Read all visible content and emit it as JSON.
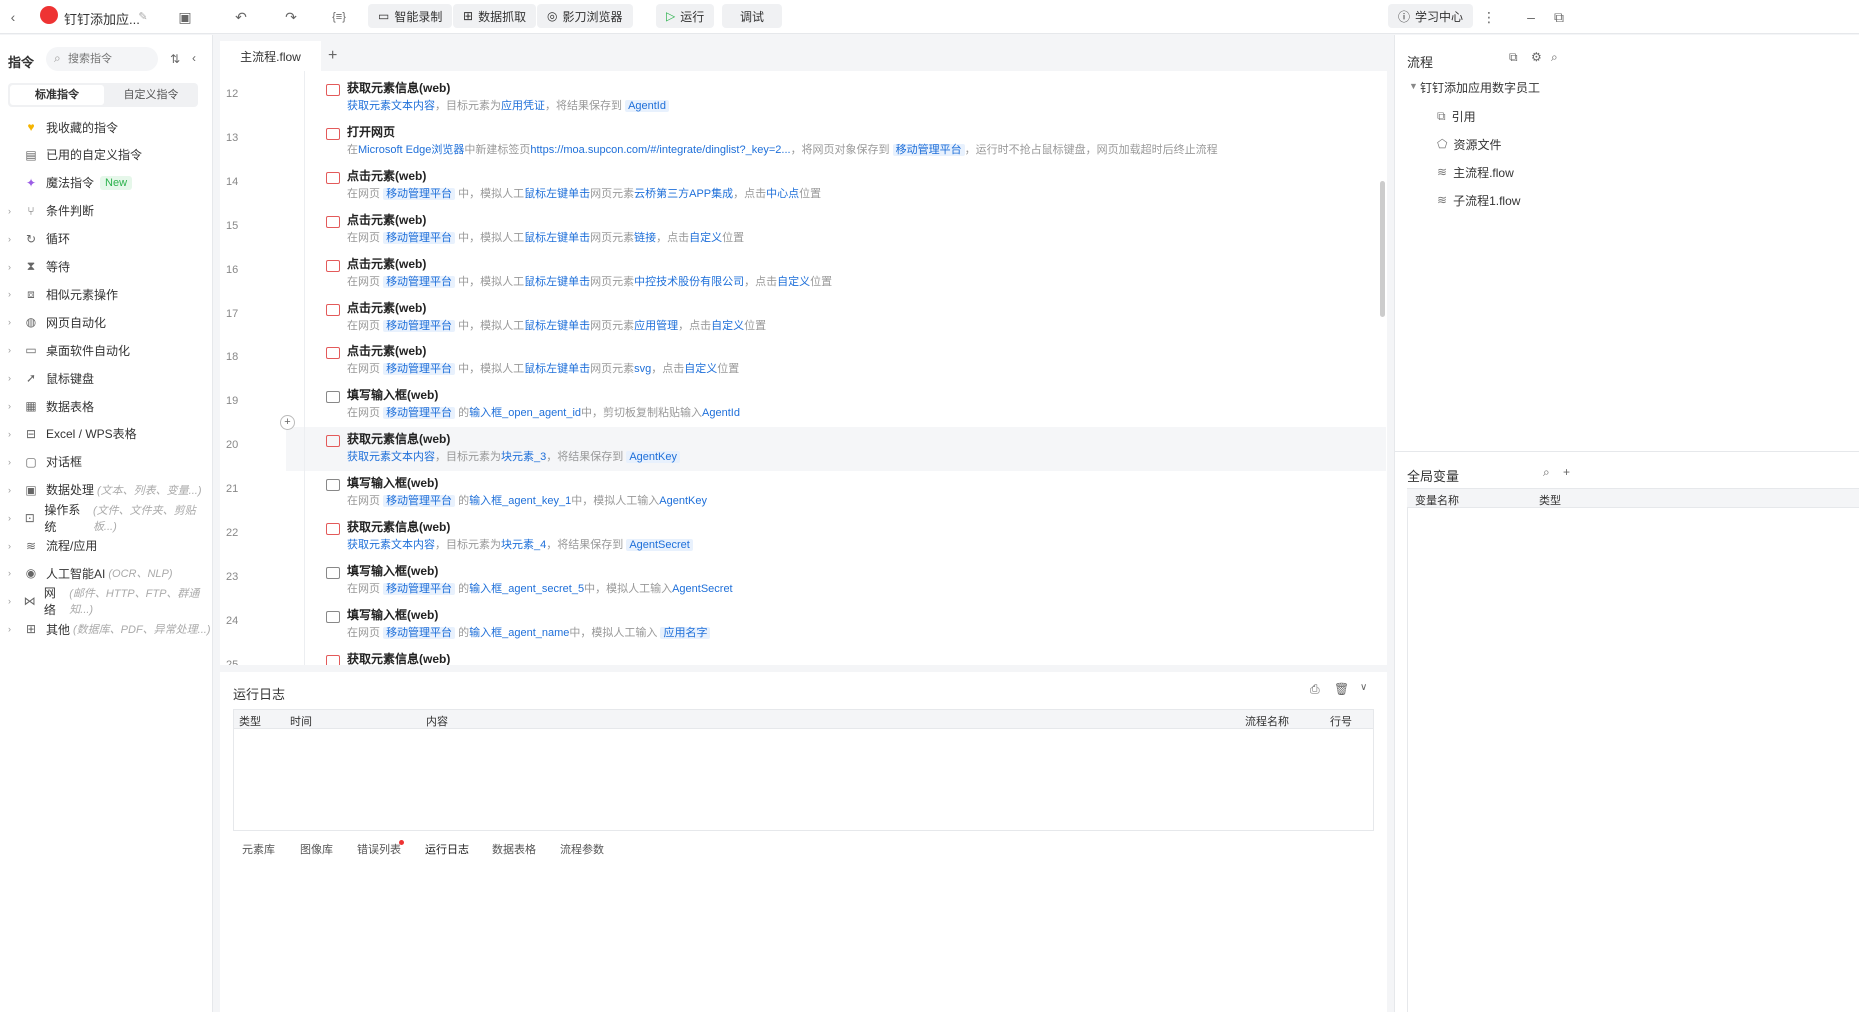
{
  "topbar": {
    "app_title": "钉钉添加应...",
    "buttons": {
      "smart_record": "智能录制",
      "data_capture": "数据抓取",
      "browser": "影刀浏览器",
      "run": "运行",
      "debug": "调试",
      "learning_center": "学习中心"
    },
    "icons": [
      "back-icon",
      "app-logo-icon",
      "edit-icon",
      "save-icon",
      "undo-icon",
      "redo-icon",
      "variable-icon",
      "more-icon",
      "minimize-icon",
      "restore-icon"
    ]
  },
  "leftpanel": {
    "title": "指令",
    "search_placeholder": "搜索指令",
    "tabs": [
      "标准指令",
      "自定义指令"
    ],
    "items": [
      {
        "label": "我收藏的指令",
        "hint": "",
        "icon": "heart-icon"
      },
      {
        "label": "已用的自定义指令",
        "hint": "",
        "icon": "custom-icon"
      },
      {
        "label": "魔法指令",
        "hint": "",
        "badge": "New",
        "icon": "magic-icon"
      },
      {
        "label": "条件判断",
        "hint": "",
        "icon": "branch-icon"
      },
      {
        "label": "循环",
        "hint": "",
        "icon": "loop-icon"
      },
      {
        "label": "等待",
        "hint": "",
        "icon": "hourglass-icon"
      },
      {
        "label": "相似元素操作",
        "hint": "",
        "icon": "similar-icon"
      },
      {
        "label": "网页自动化",
        "hint": "",
        "icon": "globe-icon"
      },
      {
        "label": "桌面软件自动化",
        "hint": "",
        "icon": "desktop-icon"
      },
      {
        "label": "鼠标键盘",
        "hint": "",
        "icon": "cursor-icon"
      },
      {
        "label": "数据表格",
        "hint": "",
        "icon": "table-icon"
      },
      {
        "label": "Excel / WPS表格",
        "hint": "",
        "icon": "excel-icon"
      },
      {
        "label": "对话框",
        "hint": "",
        "icon": "dialog-icon"
      },
      {
        "label": "数据处理",
        "hint": "(文本、列表、变量...)",
        "icon": "data-icon"
      },
      {
        "label": "操作系统",
        "hint": "(文件、文件夹、剪贴板...)",
        "icon": "os-icon"
      },
      {
        "label": "流程/应用",
        "hint": "",
        "icon": "flow-icon"
      },
      {
        "label": "人工智能AI",
        "hint": "(OCR、NLP)",
        "icon": "ai-icon"
      },
      {
        "label": "网络",
        "hint": "(邮件、HTTP、FTP、群通知...)",
        "icon": "network-icon"
      },
      {
        "label": "其他",
        "hint": "(数据库、PDF、异常处理...)",
        "icon": "grid-icon"
      }
    ]
  },
  "editor": {
    "tab": "主流程.flow",
    "rows": [
      {
        "no": "12",
        "title": "获取元素信息(web)",
        "icon": "red",
        "desc": [
          [
            "b",
            "获取元素文本内容"
          ],
          [
            "g",
            "，目标元素为"
          ],
          [
            "b",
            "应用凭证"
          ],
          [
            "g",
            "，将结果保存到 "
          ],
          [
            "c",
            "AgentId"
          ]
        ]
      },
      {
        "no": "13",
        "title": "打开网页",
        "icon": "red",
        "desc": [
          [
            "g",
            "在"
          ],
          [
            "b",
            "Microsoft Edge浏览器"
          ],
          [
            "g",
            "中新建标签页"
          ],
          [
            "b",
            "https://moa.supcon.com/#/integrate/dinglist?_key=2..."
          ],
          [
            "g",
            "，将网页对象保存到 "
          ],
          [
            "c",
            "移动管理平台"
          ],
          [
            "g",
            "，运行时不抢占鼠标键盘，网页加载超时后终止流程"
          ]
        ]
      },
      {
        "no": "14",
        "title": "点击元素(web)",
        "icon": "red",
        "desc": [
          [
            "g",
            "在网页 "
          ],
          [
            "c",
            "移动管理平台"
          ],
          [
            "g",
            " 中，模拟人工"
          ],
          [
            "b",
            "鼠标左键单击"
          ],
          [
            "g",
            "网页元素"
          ],
          [
            "b",
            "云桥第三方APP集成"
          ],
          [
            "g",
            "，点击"
          ],
          [
            "b",
            "中心点"
          ],
          [
            "g",
            "位置"
          ]
        ]
      },
      {
        "no": "15",
        "title": "点击元素(web)",
        "icon": "red",
        "desc": [
          [
            "g",
            "在网页 "
          ],
          [
            "c",
            "移动管理平台"
          ],
          [
            "g",
            " 中，模拟人工"
          ],
          [
            "b",
            "鼠标左键单击"
          ],
          [
            "g",
            "网页元素"
          ],
          [
            "b",
            "链接"
          ],
          [
            "g",
            "，点击"
          ],
          [
            "b",
            "自定义"
          ],
          [
            "g",
            "位置"
          ]
        ]
      },
      {
        "no": "16",
        "title": "点击元素(web)",
        "icon": "red",
        "desc": [
          [
            "g",
            "在网页 "
          ],
          [
            "c",
            "移动管理平台"
          ],
          [
            "g",
            " 中，模拟人工"
          ],
          [
            "b",
            "鼠标左键单击"
          ],
          [
            "g",
            "网页元素"
          ],
          [
            "b",
            "中控技术股份有限公司"
          ],
          [
            "g",
            "，点击"
          ],
          [
            "b",
            "自定义"
          ],
          [
            "g",
            "位置"
          ]
        ]
      },
      {
        "no": "17",
        "title": "点击元素(web)",
        "icon": "red",
        "desc": [
          [
            "g",
            "在网页 "
          ],
          [
            "c",
            "移动管理平台"
          ],
          [
            "g",
            " 中，模拟人工"
          ],
          [
            "b",
            "鼠标左键单击"
          ],
          [
            "g",
            "网页元素"
          ],
          [
            "b",
            "应用管理"
          ],
          [
            "g",
            "，点击"
          ],
          [
            "b",
            "自定义"
          ],
          [
            "g",
            "位置"
          ]
        ]
      },
      {
        "no": "18",
        "title": "点击元素(web)",
        "icon": "red",
        "desc": [
          [
            "g",
            "在网页 "
          ],
          [
            "c",
            "移动管理平台"
          ],
          [
            "g",
            " 中，模拟人工"
          ],
          [
            "b",
            "鼠标左键单击"
          ],
          [
            "g",
            "网页元素"
          ],
          [
            "b",
            "svg"
          ],
          [
            "g",
            "，点击"
          ],
          [
            "b",
            "自定义"
          ],
          [
            "g",
            "位置"
          ]
        ]
      },
      {
        "no": "19",
        "title": "填写输入框(web)",
        "icon": "gray",
        "desc": [
          [
            "g",
            "在网页 "
          ],
          [
            "c",
            "移动管理平台"
          ],
          [
            "g",
            " 的"
          ],
          [
            "b",
            "输入框_open_agent_id"
          ],
          [
            "g",
            "中，剪切板复制粘贴输入"
          ],
          [
            "b",
            "AgentId"
          ]
        ]
      },
      {
        "no": "20",
        "title": "获取元素信息(web)",
        "icon": "red",
        "hl": true,
        "desc": [
          [
            "b",
            "获取元素文本内容"
          ],
          [
            "g",
            "，目标元素为"
          ],
          [
            "b",
            "块元素_3"
          ],
          [
            "g",
            "，将结果保存到 "
          ],
          [
            "c",
            "AgentKey"
          ]
        ]
      },
      {
        "no": "21",
        "title": "填写输入框(web)",
        "icon": "gray",
        "desc": [
          [
            "g",
            "在网页 "
          ],
          [
            "c",
            "移动管理平台"
          ],
          [
            "g",
            " 的"
          ],
          [
            "b",
            "输入框_agent_key_1"
          ],
          [
            "g",
            "中，模拟人工输入"
          ],
          [
            "b",
            "AgentKey"
          ]
        ]
      },
      {
        "no": "22",
        "title": "获取元素信息(web)",
        "icon": "red",
        "desc": [
          [
            "b",
            "获取元素文本内容"
          ],
          [
            "g",
            "，目标元素为"
          ],
          [
            "b",
            "块元素_4"
          ],
          [
            "g",
            "，将结果保存到 "
          ],
          [
            "c",
            "AgentSecret"
          ]
        ]
      },
      {
        "no": "23",
        "title": "填写输入框(web)",
        "icon": "gray",
        "desc": [
          [
            "g",
            "在网页 "
          ],
          [
            "c",
            "移动管理平台"
          ],
          [
            "g",
            " 的"
          ],
          [
            "b",
            "输入框_agent_secret_5"
          ],
          [
            "g",
            "中，模拟人工输入"
          ],
          [
            "b",
            "AgentSecret"
          ]
        ]
      },
      {
        "no": "24",
        "title": "填写输入框(web)",
        "icon": "gray",
        "desc": [
          [
            "g",
            "在网页 "
          ],
          [
            "c",
            "移动管理平台"
          ],
          [
            "g",
            " 的"
          ],
          [
            "b",
            "输入框_agent_name"
          ],
          [
            "g",
            "中，模拟人工输入 "
          ],
          [
            "c",
            "应用名字"
          ]
        ]
      },
      {
        "no": "25",
        "title": "获取元素信息(web)",
        "icon": "red",
        "desc": []
      }
    ]
  },
  "rightpanel": {
    "flow_title": "流程",
    "tree_root": "钉钉添加应用数字员工",
    "tree_items": [
      {
        "label": "引用",
        "icon": "reference-icon"
      },
      {
        "label": "资源文件",
        "icon": "resource-icon"
      },
      {
        "label": "主流程.flow",
        "icon": "layers-icon"
      },
      {
        "label": "子流程1.flow",
        "icon": "layers-icon"
      }
    ],
    "global_vars_title": "全局变量",
    "columns": [
      "变量名称",
      "类型"
    ]
  },
  "logpanel": {
    "title": "运行日志",
    "columns": [
      "类型",
      "时间",
      "内容",
      "流程名称",
      "行号"
    ],
    "bottom_tabs": [
      "元素库",
      "图像库",
      "错误列表",
      "运行日志",
      "数据表格",
      "流程参数"
    ]
  },
  "colors": {
    "accent": "#1e6fd9",
    "run_green": "#2bb24c",
    "danger": "#e35a5a"
  }
}
